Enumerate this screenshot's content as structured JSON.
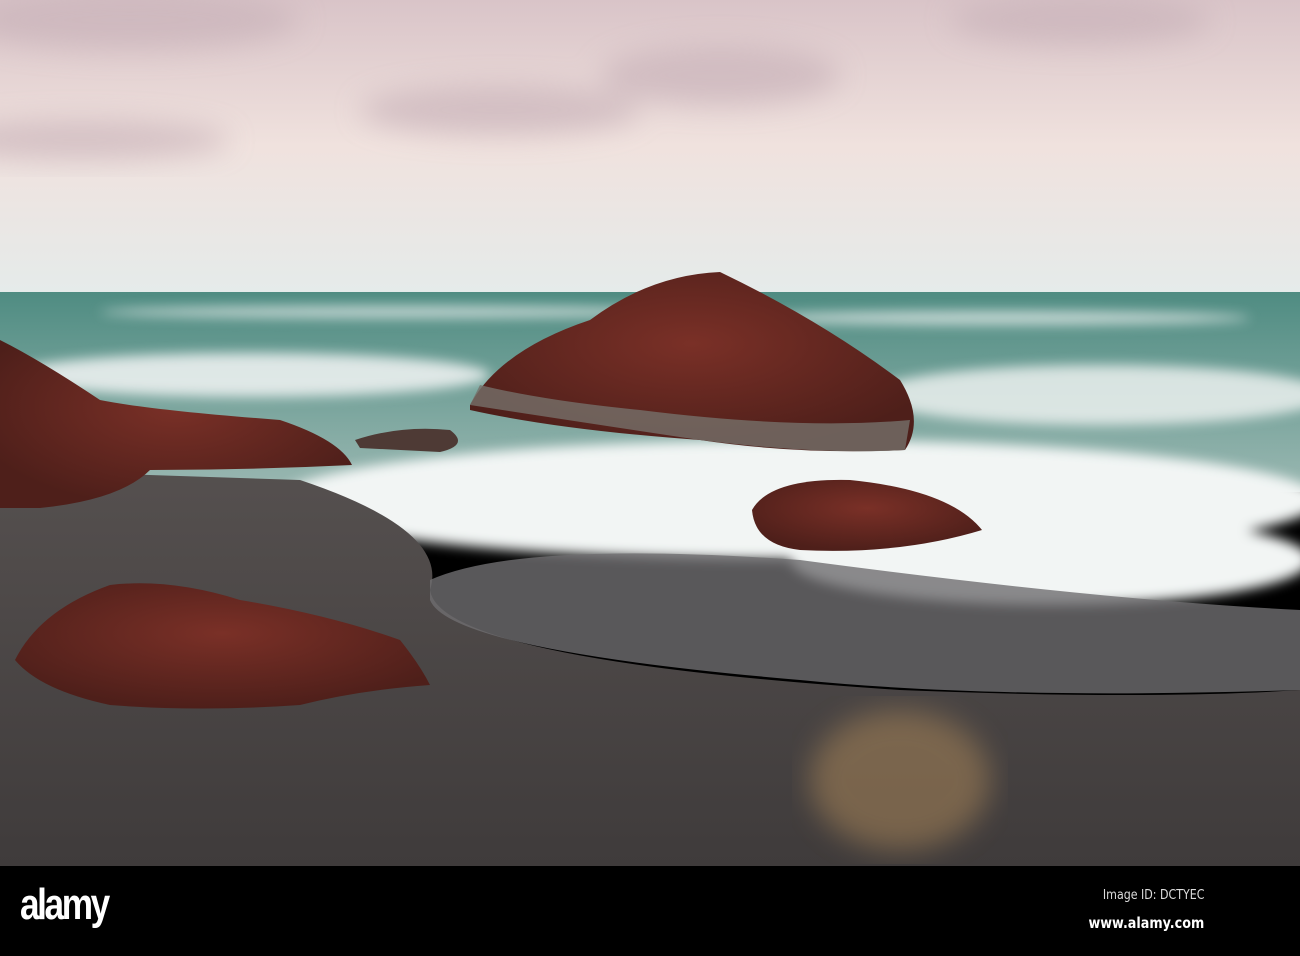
{
  "photo": {
    "subject": "Rocky beach with waves",
    "colors": {
      "sky_top": "#dcc9cc",
      "sky_horizon": "#e7eceb",
      "sea": "#5f8f86",
      "foam": "#f2f4f4",
      "sand": "#4b4847",
      "rock": "#6a2a22",
      "gold": "#b08a5a"
    }
  },
  "watermark": {
    "logo": "alamy",
    "image_id": "Image ID: DCTYEC",
    "site": "www.alamy.com"
  }
}
